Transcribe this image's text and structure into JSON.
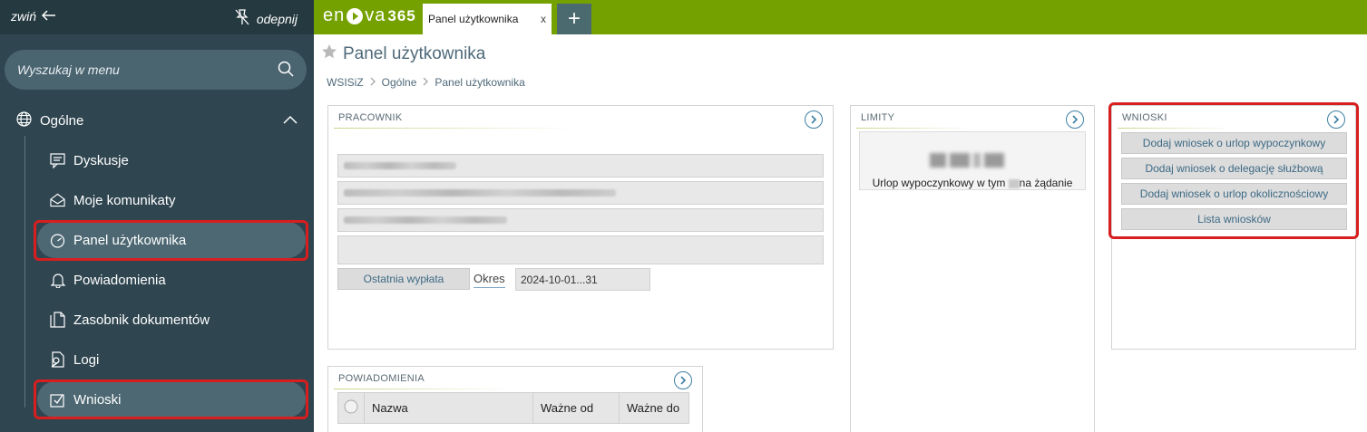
{
  "sidebar": {
    "collapse_label": "zwiń",
    "unpin_label": "odepnij",
    "search_placeholder": "Wyszukaj w menu",
    "group_label": "Ogólne",
    "items": [
      {
        "label": "Dyskusje",
        "icon": "discussion-icon"
      },
      {
        "label": "Moje komunikaty",
        "icon": "envelope-icon"
      },
      {
        "label": "Panel użytkownika",
        "icon": "gauge-icon",
        "active": true
      },
      {
        "label": "Powiadomienia",
        "icon": "bell-icon"
      },
      {
        "label": "Zasobnik dokumentów",
        "icon": "documents-icon"
      },
      {
        "label": "Logi",
        "icon": "log-search-icon"
      },
      {
        "label": "Wnioski",
        "icon": "checkbox-icon"
      }
    ]
  },
  "topbar": {
    "logo_text": "en",
    "logo_text2": "va",
    "logo_365": "365",
    "tab_label": "Panel użytkownika",
    "tab_close": "x",
    "add_tab": "+"
  },
  "page": {
    "title": "Panel użytkownika",
    "breadcrumb": [
      "WSISiZ",
      "Ogólne",
      "Panel użytkownika"
    ]
  },
  "pracownik": {
    "title": "PRACOWNIK",
    "last_pay_button": "Ostatnia wypłata",
    "period_label": "Okres",
    "period_value": "2024-10-01...31"
  },
  "limity": {
    "title": "LIMITY",
    "caption_part1": "Urlop wypoczynkowy w tym",
    "caption_part2": "na żądanie"
  },
  "wnioski": {
    "title": "WNIOSKI",
    "buttons": [
      "Dodaj wniosek o urlop wypoczynkowy",
      "Dodaj wniosek o delegację służbową",
      "Dodaj wniosek o urlop okolicznościowy",
      "Lista wniosków"
    ]
  },
  "powiadomienia": {
    "title": "POWIADOMIENIA",
    "columns": [
      "Nazwa",
      "Ważne od",
      "Ważne do"
    ]
  },
  "colors": {
    "sidebar_bg": "#2f4550",
    "topbar_green": "#74a100",
    "highlight_red": "#d81e1e",
    "link_blue": "#3d6a85"
  }
}
